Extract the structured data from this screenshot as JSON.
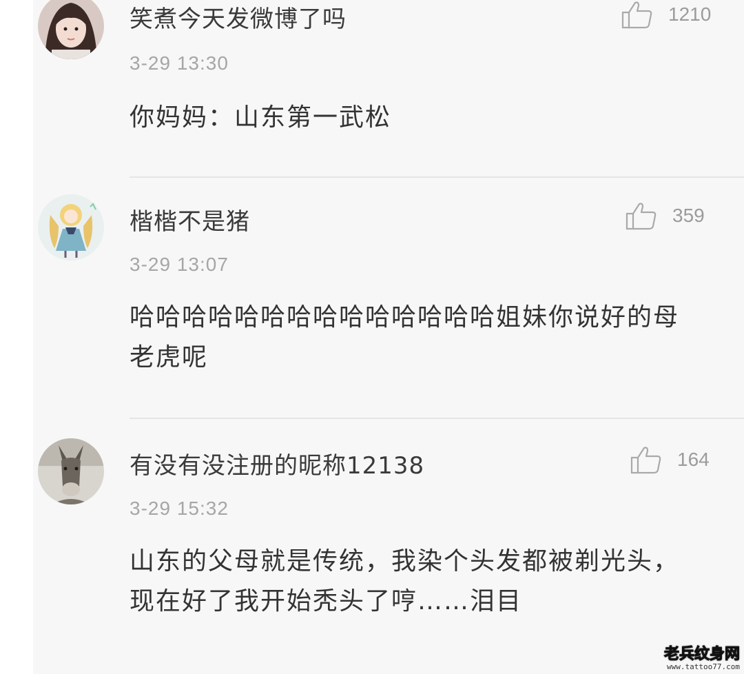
{
  "comments": [
    {
      "username": "笑煮今天发微博了吗",
      "likes": "1210",
      "time": "3-29 13:30",
      "text": "你妈妈：山东第一武松",
      "avatar": "girl-portrait-avatar"
    },
    {
      "username": "楷楷不是猪",
      "likes": "359",
      "time": "3-29 13:07",
      "text": "哈哈哈哈哈哈哈哈哈哈哈哈哈哈姐妹你说好的母老虎呢",
      "avatar": "cartoon-girl-avatar"
    },
    {
      "username": "有没有没注册的昵称12138",
      "likes": "164",
      "time": "3-29 15:32",
      "text": "山东的父母就是传统，我染个头发都被剃光头，现在好了我开始秃头了哼……泪目",
      "avatar": "donkey-avatar"
    }
  ],
  "watermark": {
    "name": "老兵纹身网",
    "url": "www.tattoo77.com"
  },
  "colors": {
    "background": "#f7f7f7",
    "username": "#3a3a3a",
    "meta": "#a6a6a6",
    "body": "#333333",
    "divider": "#e4e4e4"
  }
}
